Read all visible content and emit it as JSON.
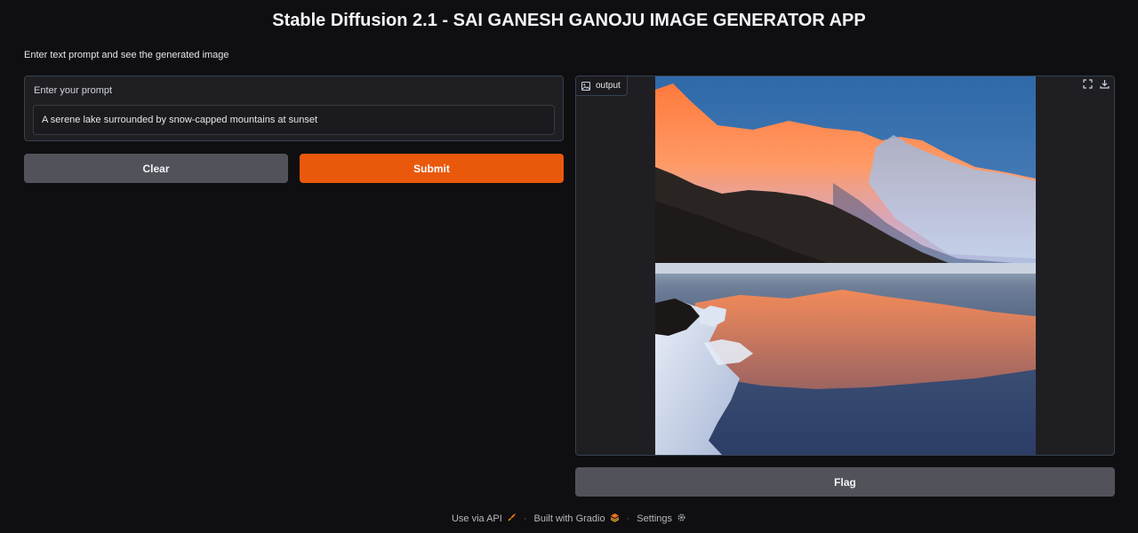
{
  "app": {
    "title": "Stable Diffusion 2.1 - SAI GANESH GANOJU IMAGE GENERATOR APP",
    "description": "Enter text prompt and see the generated image"
  },
  "prompt": {
    "label": "Enter your prompt",
    "value": "A serene lake surrounded by snow-capped mountains at sunset"
  },
  "buttons": {
    "clear_label": "Clear",
    "submit_label": "Submit",
    "flag_label": "Flag"
  },
  "output": {
    "label": "output",
    "label_icon": "image-icon",
    "tools": [
      "fullscreen-icon",
      "download-icon"
    ]
  },
  "footer": {
    "api_label": "Use via API",
    "api_icon": "rocket-icon",
    "built_label": "Built with Gradio",
    "built_icon": "gradio-logo-icon",
    "settings_label": "Settings",
    "settings_icon": "gear-icon",
    "separator": "·"
  },
  "colors": {
    "background": "#0f0f11",
    "panel": "#1f1f23",
    "accent": "#ea580c",
    "secondary_button": "#52525b"
  }
}
